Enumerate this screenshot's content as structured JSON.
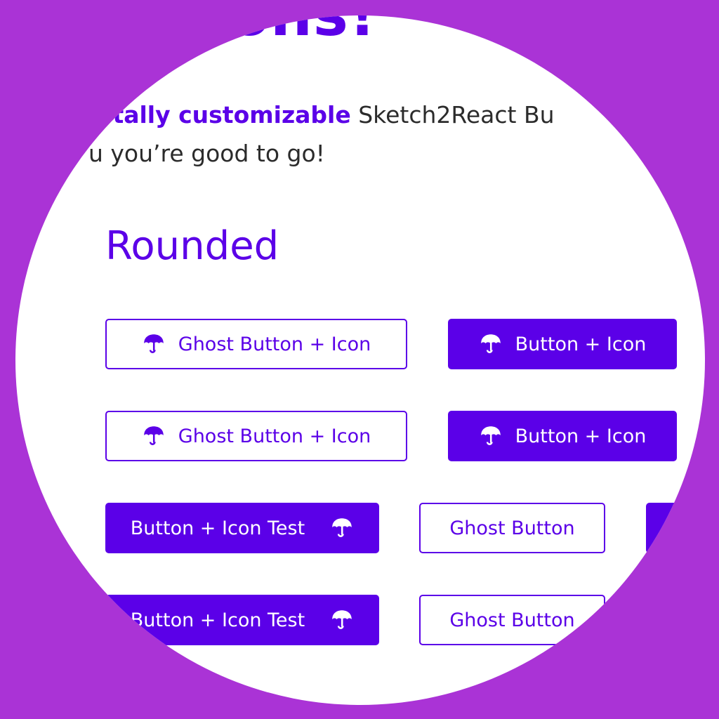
{
  "header": {
    "title_fragment": "ttons!",
    "intro_emphasis": "totally customizable",
    "intro_rest": " Sketch2React Bu",
    "intro_line2": "u you’re good to go!"
  },
  "section": {
    "title": "Rounded"
  },
  "buttons": {
    "r1_ghost": "Ghost Button + Icon",
    "r1_solid": "Button + Icon",
    "r2_ghost": "Ghost Button + Icon",
    "r2_solid": "Button + Icon",
    "r3_solid": "Button + Icon Test",
    "r3_ghost": "Ghost Button",
    "r4_solid": "Button + Icon Test",
    "r4_ghost": "Ghost Button"
  },
  "icons": {
    "button_icon": "umbrella-icon"
  },
  "colors": {
    "background": "#aa33d6",
    "accent": "#5b00e8",
    "card": "#ffffff",
    "text": "#2b2b2b"
  }
}
